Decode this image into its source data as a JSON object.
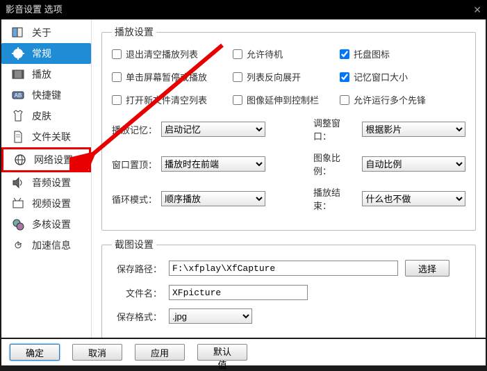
{
  "window": {
    "title": "影音设置 选项"
  },
  "sidebar": {
    "items": [
      {
        "label": "关于"
      },
      {
        "label": "常规"
      },
      {
        "label": "播放"
      },
      {
        "label": "快捷键"
      },
      {
        "label": "皮肤"
      },
      {
        "label": "文件关联"
      },
      {
        "label": "网络设置"
      },
      {
        "label": "音频设置"
      },
      {
        "label": "视频设置"
      },
      {
        "label": "多核设置"
      },
      {
        "label": "加速信息"
      }
    ]
  },
  "playback": {
    "legend": "播放设置",
    "chk": {
      "clear_on_exit": "退出清空播放列表",
      "allow_standby": "允许待机",
      "tray_icon": "托盘图标",
      "click_pause": "单击屏幕暂停或播放",
      "list_reverse": "列表反向展开",
      "remember_size": "记忆窗口大小",
      "open_clear": "打开新文件清空列表",
      "image_extend": "图像延伸到控制栏",
      "allow_multi": "允许运行多个先锋"
    },
    "sel": {
      "play_memory_l": "播放记忆：",
      "play_memory_v": "启动记忆",
      "resize_l": "调整窗口：",
      "resize_v": "根据影片",
      "window_top_l": "窗口置顶：",
      "window_top_v": "播放时在前端",
      "image_ratio_l": "图象比例：",
      "image_ratio_v": "自动比例",
      "loop_l": "循环模式：",
      "loop_v": "顺序播放",
      "end_l": "播放结束：",
      "end_v": "什么也不做"
    }
  },
  "capture": {
    "legend": "截图设置",
    "path_l": "保存路径：",
    "path_v": "F:\\xfplay\\XfCapture",
    "browse": "选择",
    "name_l": "文件名：",
    "name_v": "XFpicture",
    "format_l": "保存格式：",
    "format_v": ".jpg"
  },
  "footer": {
    "ok": "确定",
    "cancel": "取消",
    "apply": "应用",
    "default": "默认值"
  }
}
